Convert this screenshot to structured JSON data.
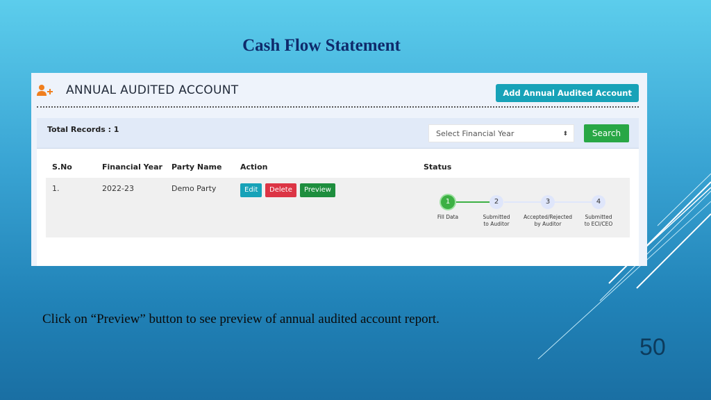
{
  "slide": {
    "title": "Cash Flow Statement",
    "caption": "Click on “Preview” button to see preview of annual audited account report.",
    "page_number": "50"
  },
  "app": {
    "page_title": "ANNUAL AUDITED ACCOUNT",
    "page_icon": "user-plus-icon",
    "add_button_label": "Add Annual Audited Account",
    "total_records_label": "Total Records : 1",
    "financial_year_select": {
      "selected": "Select Financial Year",
      "icon": "sort-arrows-icon"
    },
    "search_button_label": "Search",
    "table": {
      "columns": [
        "S.No",
        "Financial Year",
        "Party Name",
        "Action",
        "Status"
      ],
      "rows": [
        {
          "sno": "1.",
          "financial_year": "2022-23",
          "party_name": "Demo Party",
          "actions": [
            "Edit",
            "Delete",
            "Preview"
          ]
        }
      ]
    },
    "status_steps": [
      {
        "number": "1",
        "label_line1": "Fill Data",
        "label_line2": "",
        "state": "active"
      },
      {
        "number": "2",
        "label_line1": "Submitted",
        "label_line2": "to Auditor",
        "state": "pending"
      },
      {
        "number": "3",
        "label_line1": "Accepted/Rejected",
        "label_line2": "by Auditor",
        "state": "pending"
      },
      {
        "number": "4",
        "label_line1": "Submitted",
        "label_line2": "to ECI/CEO",
        "state": "pending"
      }
    ],
    "colors": {
      "add_button": "#17a2b8",
      "search_button": "#28a745",
      "edit_button": "#17a2b8",
      "delete_button": "#dc3545",
      "preview_button": "#1e8e3e",
      "step_active": "#3cb043",
      "step_pending": "#dfe6fb",
      "icon_orange": "#f07f1e"
    }
  }
}
